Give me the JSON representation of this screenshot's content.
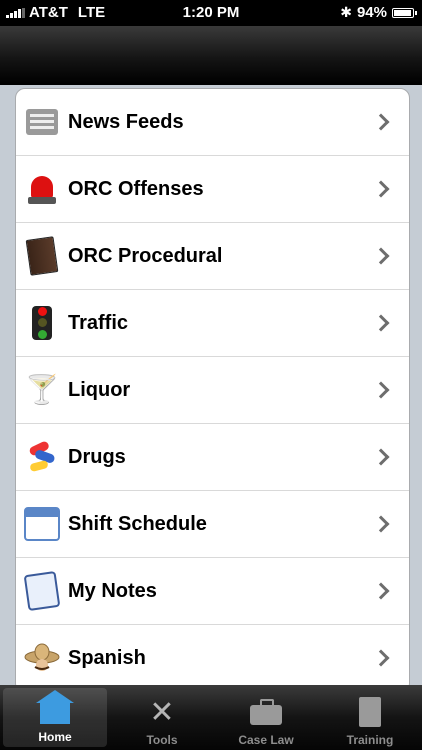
{
  "status_bar": {
    "carrier": "AT&T",
    "network": "LTE",
    "time": "1:20 PM",
    "battery": "94%",
    "battery_level": 0.94
  },
  "menu": {
    "items": [
      {
        "label": "News Feeds",
        "icon": "newspaper-icon"
      },
      {
        "label": "ORC Offenses",
        "icon": "siren-icon"
      },
      {
        "label": "ORC Procedural",
        "icon": "book-icon"
      },
      {
        "label": "Traffic",
        "icon": "traffic-light-icon"
      },
      {
        "label": "Liquor",
        "icon": "martini-glass-icon"
      },
      {
        "label": "Drugs",
        "icon": "pills-icon"
      },
      {
        "label": "Shift Schedule",
        "icon": "calendar-icon"
      },
      {
        "label": "My Notes",
        "icon": "notepad-pencil-icon"
      },
      {
        "label": "Spanish",
        "icon": "sombrero-icon"
      }
    ]
  },
  "tab_bar": {
    "tabs": [
      {
        "label": "Home",
        "icon": "home-icon",
        "active": true
      },
      {
        "label": "Tools",
        "icon": "tools-icon",
        "active": false
      },
      {
        "label": "Case Law",
        "icon": "briefcase-icon",
        "active": false
      },
      {
        "label": "Training",
        "icon": "book-icon",
        "active": false
      }
    ]
  }
}
